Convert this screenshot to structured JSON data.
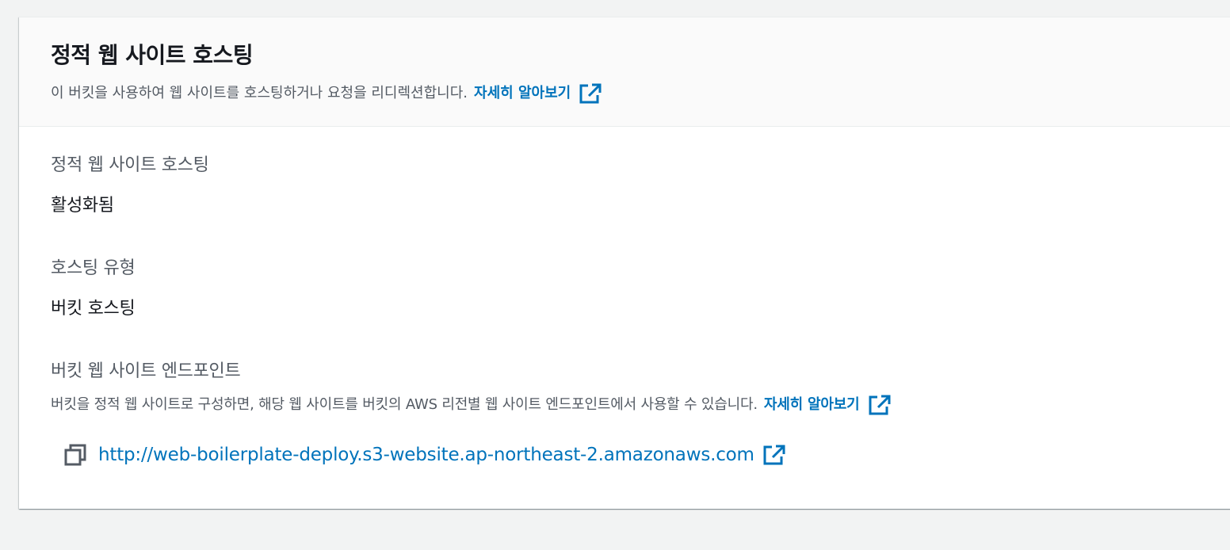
{
  "header": {
    "title": "정적 웹 사이트 호스팅",
    "description": "이 버킷을 사용하여 웹 사이트를 호스팅하거나 요청을 리디렉션합니다.",
    "learn_more": "자세히 알아보기"
  },
  "static_hosting": {
    "label": "정적 웹 사이트 호스팅",
    "value": "활성화됨"
  },
  "hosting_type": {
    "label": "호스팅 유형",
    "value": "버킷 호스팅"
  },
  "endpoint": {
    "label": "버킷 웹 사이트 엔드포인트",
    "description": "버킷을 정적 웹 사이트로 구성하면, 해당 웹 사이트를 버킷의 AWS 리전별 웹 사이트 엔드포인트에서 사용할 수 있습니다.",
    "learn_more": "자세히 알아보기",
    "url": "http://web-boilerplate-deploy.s3-website.ap-northeast-2.amazonaws.com"
  },
  "icons": {
    "external_link": "external-link-icon",
    "copy": "copy-icon"
  },
  "colors": {
    "link": "#0073bb",
    "text": "#16191f",
    "secondary_text": "#545b64",
    "header_bg": "#fafafa",
    "page_bg": "#f2f3f3"
  }
}
